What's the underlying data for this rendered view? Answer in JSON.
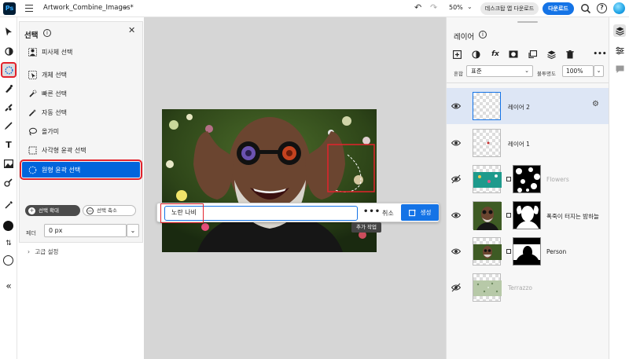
{
  "app": {
    "logo": "Ps",
    "document_title": "Artwork_Combine_Images*",
    "zoom": "50%",
    "desktop_button": "데스크탑 앱 다운로드",
    "download_button": "다운로드"
  },
  "selection_panel": {
    "title": "선택",
    "items": [
      {
        "label": "피사체 선택",
        "icon": "subject-icon"
      },
      {
        "label": "개체 선택",
        "icon": "object-select-icon"
      },
      {
        "label": "빠른 선택",
        "icon": "quick-select-icon"
      },
      {
        "label": "자동 선택",
        "icon": "magic-wand-icon"
      },
      {
        "label": "올가미",
        "icon": "lasso-icon"
      },
      {
        "label": "사각형 윤곽 선택",
        "icon": "rect-marquee-icon"
      },
      {
        "label": "원형 윤곽 선택",
        "icon": "ellipse-marquee-icon"
      }
    ],
    "active_item": "원형 윤곽 선택",
    "expand_label": "선택 확대",
    "shrink_label": "선택 축소",
    "feather_label": "페더",
    "feather_value": "0 px",
    "advanced_label": "고급 설정"
  },
  "prompt_bar": {
    "input_value": "노란 나비",
    "cancel_label": "취소",
    "generate_label": "생성",
    "tooltip": "추가 작업"
  },
  "layers_panel": {
    "title": "레이어",
    "blend_label": "혼합",
    "blend_mode": "표준",
    "opacity_label": "불투명도",
    "opacity_value": "100%",
    "layers": [
      {
        "name": "레이어 2",
        "visible": true,
        "selected": true
      },
      {
        "name": "레이어 1",
        "visible": true,
        "selected": false
      },
      {
        "name": "Flowers",
        "visible": false,
        "selected": false
      },
      {
        "name": "폭죽이 터지는 밤하늘",
        "visible": true,
        "selected": false
      },
      {
        "name": "Person",
        "visible": true,
        "selected": false
      },
      {
        "name": "Terrazzo",
        "visible": false,
        "selected": false
      }
    ]
  },
  "colors": {
    "accent": "#1473e6",
    "selected_blue": "#0265dc",
    "highlight_red": "#e3232c"
  }
}
